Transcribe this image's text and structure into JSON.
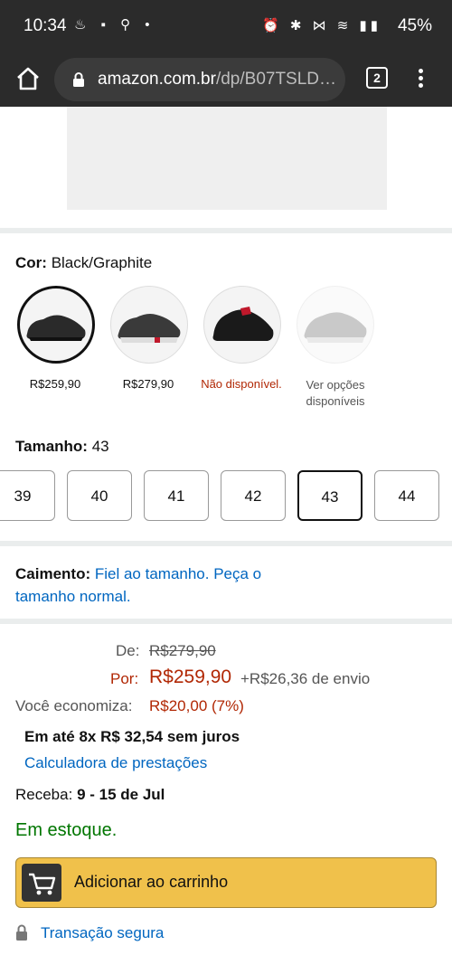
{
  "statusbar": {
    "time": "10:34",
    "battery": "45%"
  },
  "browser": {
    "url_host": "amazon.com.br",
    "url_path": "/dp/B07TSLD…",
    "tab_count": "2"
  },
  "color": {
    "label": "Cor:",
    "value": "Black/Graphite",
    "swatches": [
      {
        "price": "R$259,90"
      },
      {
        "price": "R$279,90"
      },
      {
        "price": "Não disponível."
      },
      {
        "price": "Ver opções disponíveis"
      }
    ]
  },
  "size": {
    "label": "Tamanho:",
    "value": "43",
    "options": [
      "39",
      "40",
      "41",
      "42",
      "43",
      "44"
    ]
  },
  "fit": {
    "label": "Caimento:",
    "text": "Fiel ao tamanho. Peça o tamanho normal."
  },
  "pricing": {
    "was_label": "De:",
    "was_price": "R$279,90",
    "now_label": "Por:",
    "now_price": "R$259,90",
    "shipping": "+R$26,36 de envio",
    "savings_label": "Você economiza:",
    "savings_value": "R$20,00 (7%)",
    "installments": "Em até 8x R$ 32,54 sem juros",
    "calculator_link": "Calculadora de prestações",
    "delivery_label": "Receba:",
    "delivery_value": "9 - 15 de Jul",
    "stock": "Em estoque."
  },
  "cart": {
    "label": "Adicionar ao carrinho"
  },
  "secure": {
    "label": "Transação segura"
  }
}
